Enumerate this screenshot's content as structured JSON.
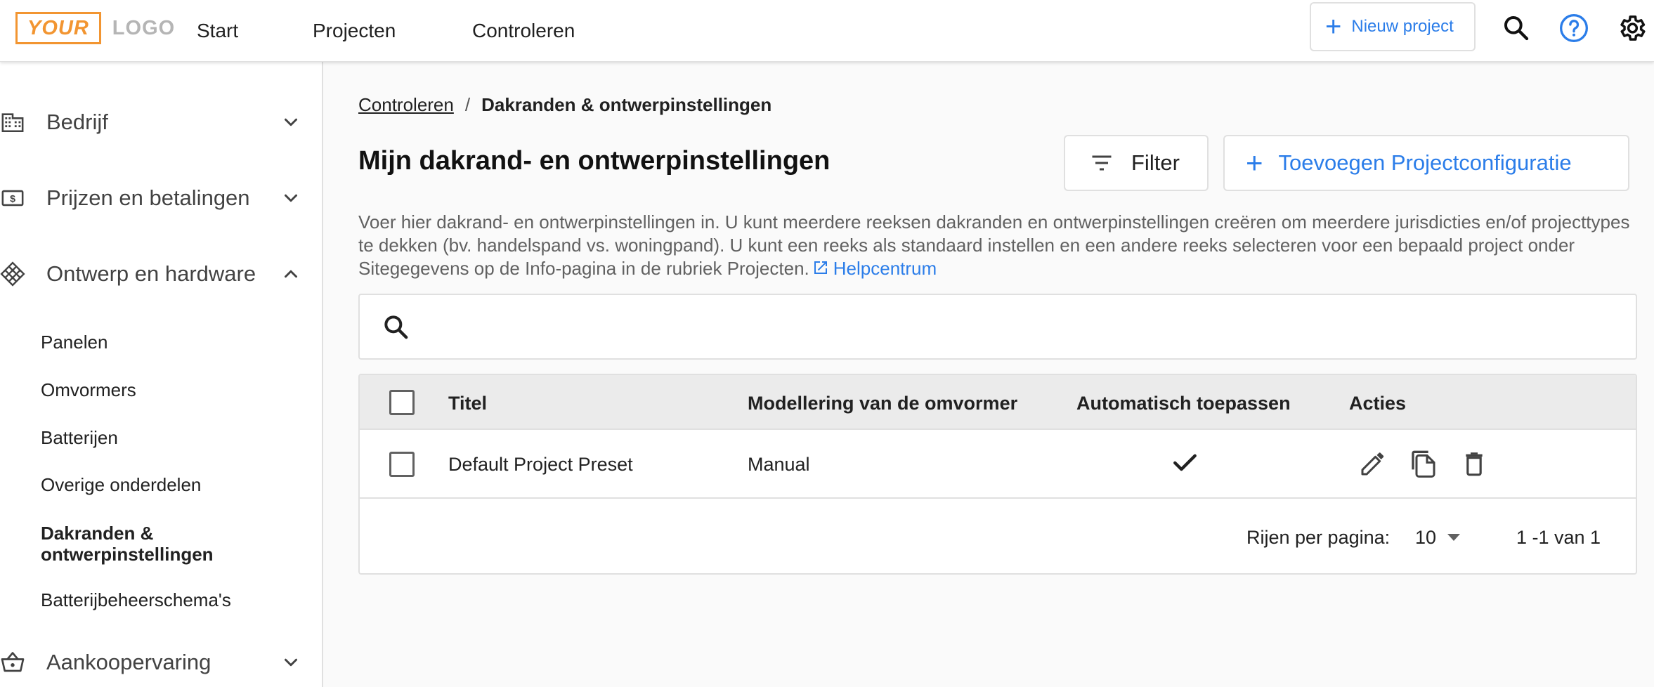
{
  "header": {
    "logo_left": "YOUR",
    "logo_right": "LOGO",
    "nav": [
      "Start",
      "Projecten",
      "Controleren"
    ],
    "new_project_label": "Nieuw project",
    "accent_color": "#2b7de9",
    "logo_color": "#f29531"
  },
  "sidebar": {
    "groups": [
      {
        "label": "Bedrijf",
        "icon": "building-icon",
        "expanded": false
      },
      {
        "label": "Prijzen en betalingen",
        "icon": "money-icon",
        "expanded": false
      },
      {
        "label": "Ontwerp en hardware",
        "icon": "grid-icon",
        "expanded": true
      },
      {
        "label": "Aankoopervaring",
        "icon": "basket-icon",
        "expanded": false
      }
    ],
    "items": [
      {
        "label": "Panelen",
        "active": false
      },
      {
        "label": "Omvormers",
        "active": false
      },
      {
        "label": "Batterijen",
        "active": false
      },
      {
        "label": "Overige onderdelen",
        "active": false
      },
      {
        "label": "Dakranden & ontwerpinstellingen",
        "active": true
      },
      {
        "label": "Batterijbeheerschema's",
        "active": false
      }
    ]
  },
  "breadcrumb": {
    "parent": "Controleren",
    "separator": "/",
    "current": "Dakranden & ontwerpinstellingen"
  },
  "main": {
    "title": "Mijn dakrand- en ontwerpinstellingen",
    "filter_label": "Filter",
    "add_label": "Toevoegen Projectconfiguratie",
    "description": "Voer hier dakrand- en ontwerpinstellingen in. U kunt meerdere reeksen dakranden en ontwerpinstellingen creëren om meerdere jurisdicties en/of projecttypes te dekken (bv. handelspand vs. woningpand). U kunt een reeks als standaard instellen en een andere reeks selecteren voor een bepaald project onder Sitegegevens op de Info-pagina in de rubriek Projecten.",
    "help_link": "Helpcentrum",
    "search_placeholder": ""
  },
  "table": {
    "columns": [
      "Titel",
      "Modellering van de omvormer",
      "Automatisch toepassen",
      "Acties"
    ],
    "rows": [
      {
        "title": "Default Project Preset",
        "modeling": "Manual",
        "auto_apply": true,
        "actions": [
          "edit-icon",
          "copy-icon",
          "delete-icon"
        ]
      }
    ],
    "rows_per_page_label": "Rijen per pagina:",
    "rows_per_page": "10",
    "range": "1 -1 van 1"
  }
}
